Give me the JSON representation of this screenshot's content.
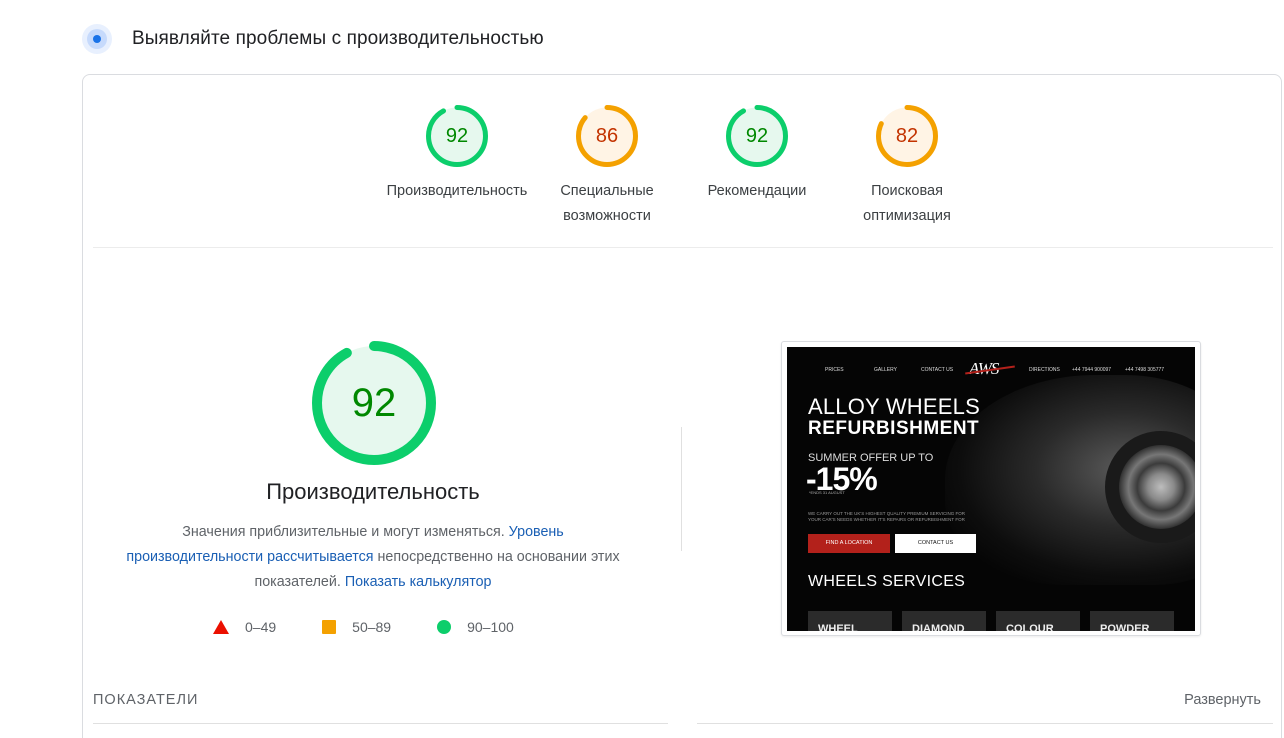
{
  "header": {
    "title": "Выявляйте проблемы с производительностью",
    "icon": "lighthouse-icon"
  },
  "scores": [
    {
      "id": "performance",
      "value": 92,
      "label": "Производительность",
      "status": "good"
    },
    {
      "id": "accessibility",
      "value": 86,
      "label": "Специальные возможности",
      "status": "average"
    },
    {
      "id": "best_practices",
      "value": 92,
      "label": "Рекомендации",
      "status": "good"
    },
    {
      "id": "seo",
      "value": 82,
      "label": "Поисковая оптимизация",
      "status": "average"
    }
  ],
  "performance": {
    "value": 92,
    "title": "Производительность",
    "desc_part1": "Значения приблизительные и могут изменяться. ",
    "desc_link1": "Уровень производительности рассчитывается",
    "desc_part2": " непосредственно на основании этих показателей. ",
    "desc_link2": "Показать калькулятор"
  },
  "legend": [
    {
      "shape": "triangle",
      "range": "0–49",
      "color": "#eb0f00"
    },
    {
      "shape": "square",
      "range": "50–89",
      "color": "#f4a100"
    },
    {
      "shape": "circle",
      "range": "90–100",
      "color": "#0cce6b"
    }
  ],
  "site": {
    "nav": [
      "PRICES",
      "GALLERY",
      "CONTACT US",
      "DIRECTIONS",
      "+44 7944 900097",
      "+44 7498 305777"
    ],
    "logo": "AWS",
    "headline1": "ALLOY WHEELS",
    "headline2": "REFURBISHMENT",
    "offer": "SUMMER OFFER UP TO",
    "percent": "-15%",
    "ends": "*ENDS 31 AUGUST",
    "small_text": "WE CARRY OUT THE UK'S HIGHEST QUALITY PREMIUM SERVICING FOR YOUR CAR'S NEEDS WHETHER IT'S REPAIRS OR REFURBISHMENT FOR",
    "button1": "FIND A LOCATION",
    "button2": "CONTACT US",
    "services_title": "WHEELS SERVICES",
    "tiles": [
      "WHEEL",
      "DIAMOND",
      "COLOUR",
      "POWDER"
    ]
  },
  "metrics": {
    "label": "ПОКАЗАТЕЛИ",
    "expand": "Развернуть"
  },
  "colors": {
    "good": "#0cce6b",
    "good_text": "#008800",
    "good_fill": "#e6f8ee",
    "average": "#f4a100",
    "average_text": "#c33300",
    "average_fill": "#fff4e5",
    "link": "#1a5fb4"
  }
}
